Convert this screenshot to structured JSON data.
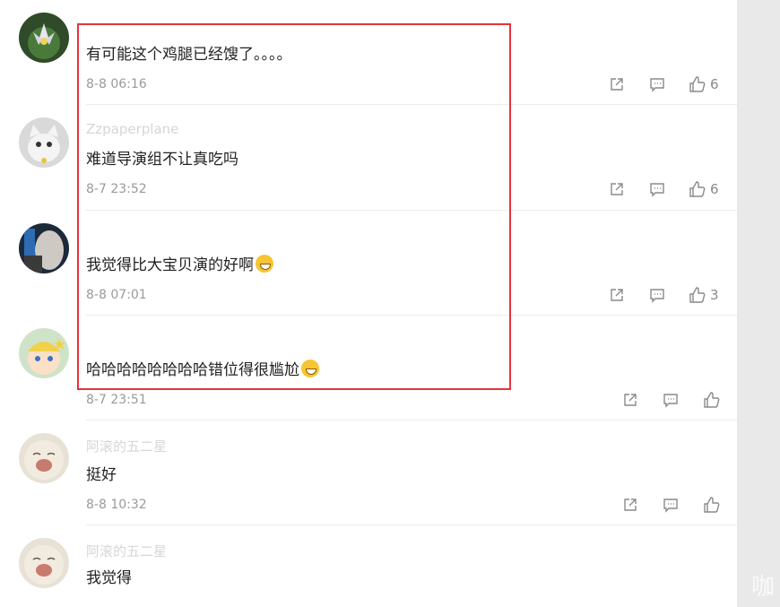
{
  "comments": [
    {
      "username": "",
      "text": "有可能这个鸡腿已经馊了。。。。",
      "time": "8-8 06:16",
      "likes": "6"
    },
    {
      "username": "Zzpaperplane",
      "text": "难道导演组不让真吃吗",
      "time": "8-7 23:52",
      "likes": "6"
    },
    {
      "username": "",
      "text": "我觉得比大宝贝演的好啊",
      "time": "8-8 07:01",
      "likes": "3",
      "emoji": "laughing-tears-emoji"
    },
    {
      "username": "",
      "text": "哈哈哈哈哈哈哈哈错位得很尴尬",
      "time": "8-7 23:51",
      "likes": "",
      "emoji": "grinning-emoji"
    },
    {
      "username": "阿滚的五二星",
      "text": "挺好",
      "time": "8-8 10:32",
      "likes": ""
    },
    {
      "username": "阿滚的五二星",
      "text": "我觉得",
      "time": "",
      "likes": ""
    }
  ],
  "highlight_color": "#e8323c",
  "watermark": "咖",
  "icons": {
    "share": "share-icon",
    "reply": "comment-icon",
    "like": "thumbs-up-icon"
  }
}
